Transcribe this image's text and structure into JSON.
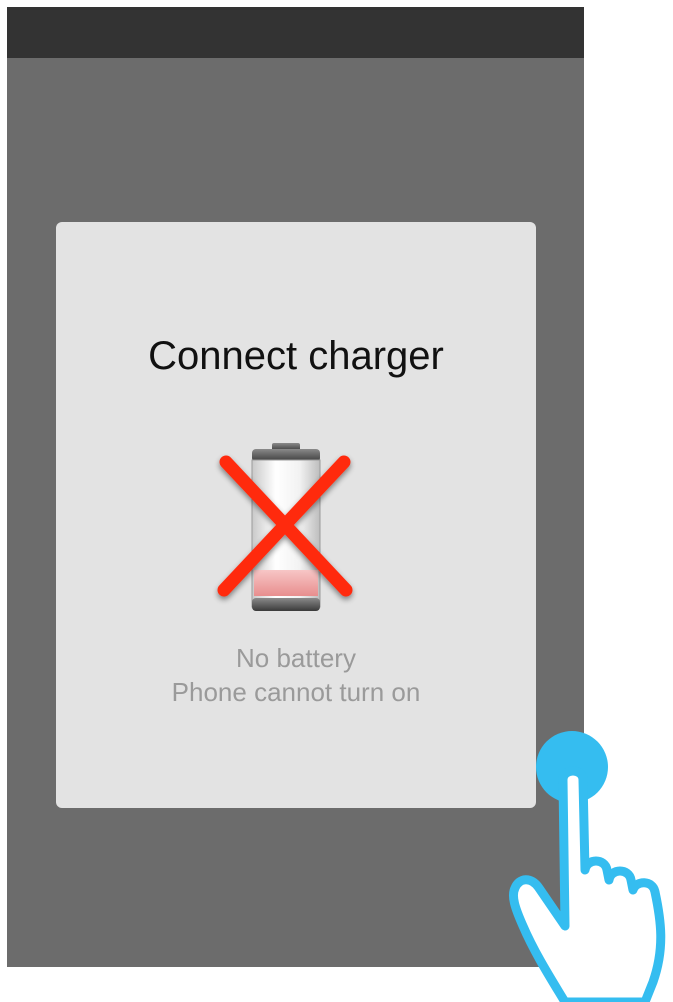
{
  "dialog": {
    "title": "Connect charger",
    "message_line1": "No battery",
    "message_line2": "Phone cannot turn on",
    "icon": "no-battery-icon"
  },
  "gesture": {
    "icon": "tap-hand-icon",
    "touch_indicator": "touch-point"
  },
  "colors": {
    "screen_background": "#6c6c6c",
    "status_bar": "#333333",
    "dialog_background": "#e3e3e3",
    "cross": "#ff2a10",
    "touch_point": "#35bdf0",
    "message_text": "#9a9a9a"
  }
}
